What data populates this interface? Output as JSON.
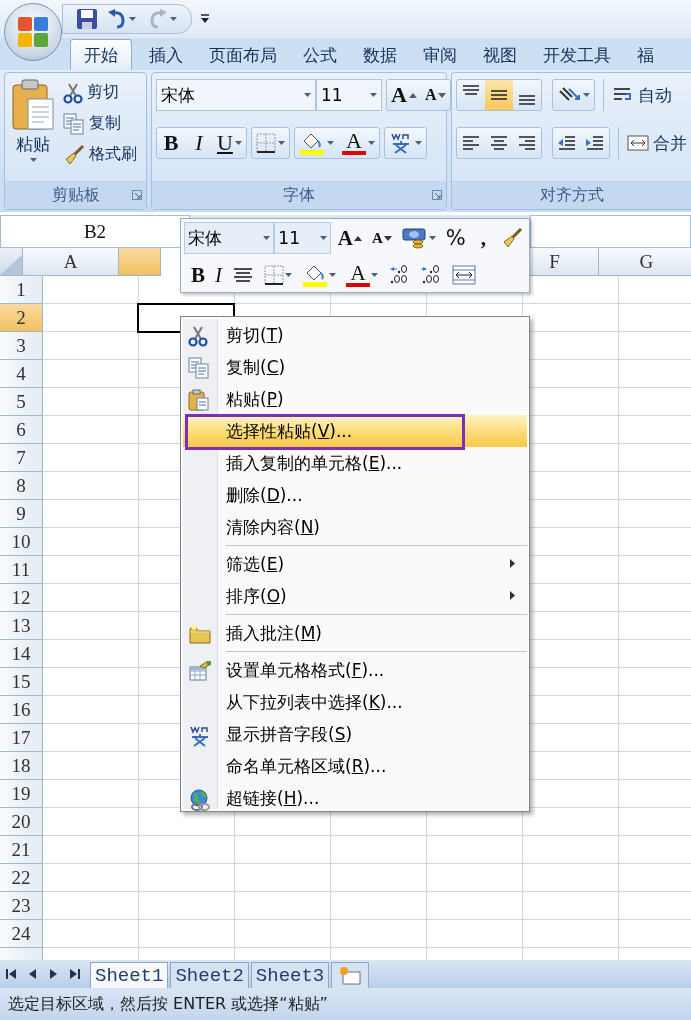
{
  "ribbon_tabs": [
    {
      "label": "开始",
      "selected": true
    },
    {
      "label": "插入",
      "selected": false
    },
    {
      "label": "页面布局",
      "selected": false
    },
    {
      "label": "公式",
      "selected": false
    },
    {
      "label": "数据",
      "selected": false
    },
    {
      "label": "审阅",
      "selected": false
    },
    {
      "label": "视图",
      "selected": false
    },
    {
      "label": "开发工具",
      "selected": false
    },
    {
      "label": "福",
      "selected": false
    }
  ],
  "clipboard": {
    "title": "剪贴板",
    "paste": "粘贴",
    "commands": [
      {
        "label": "剪切"
      },
      {
        "label": "复制"
      },
      {
        "label": "格式刷"
      }
    ]
  },
  "font": {
    "title": "字体",
    "font_name": "宋体",
    "font_size": "11",
    "grow": "A",
    "shrink": "A",
    "bold": "B",
    "italic": "I",
    "underline": "U",
    "font_color": "A"
  },
  "alignment": {
    "title": "对齐方式",
    "vertical": [
      {
        "selected": false
      },
      {
        "selected": true
      },
      {
        "selected": false
      }
    ],
    "wrap_text": "自动",
    "merge": "合并"
  },
  "name_box": "B2",
  "columns": [
    {
      "kind": "header",
      "label": "A",
      "selected": false
    },
    {
      "kind": "partial",
      "selected": true
    },
    {
      "kind": "covered"
    },
    {
      "kind": "covered"
    },
    {
      "kind": "covered"
    },
    {
      "kind": "header",
      "label": "F",
      "selected": false
    },
    {
      "kind": "header",
      "label": "G",
      "selected": false
    }
  ],
  "rows": [
    {
      "label": "1",
      "selected": false
    },
    {
      "label": "2",
      "selected": true
    },
    {
      "label": "3",
      "selected": false
    },
    {
      "label": "4",
      "selected": false
    },
    {
      "label": "5",
      "selected": false
    },
    {
      "label": "6",
      "selected": false
    },
    {
      "label": "7",
      "selected": false
    },
    {
      "label": "8",
      "selected": false
    },
    {
      "label": "9",
      "selected": false
    },
    {
      "label": "10",
      "selected": false
    },
    {
      "label": "11",
      "selected": false
    },
    {
      "label": "12",
      "selected": false
    },
    {
      "label": "13",
      "selected": false
    },
    {
      "label": "14",
      "selected": false
    },
    {
      "label": "15",
      "selected": false
    },
    {
      "label": "16",
      "selected": false
    },
    {
      "label": "17",
      "selected": false
    },
    {
      "label": "18",
      "selected": false
    },
    {
      "label": "19",
      "selected": false
    },
    {
      "label": "20",
      "selected": false
    },
    {
      "label": "21",
      "selected": false
    },
    {
      "label": "22",
      "selected": false
    },
    {
      "label": "23",
      "selected": false
    },
    {
      "label": "24",
      "selected": false
    }
  ],
  "mini_toolbar": {
    "font_name": "宋体",
    "font_size": "11",
    "grow": "A",
    "shrink": "A",
    "percent": "%",
    "comma": ",",
    "bold": "B",
    "italic": "I",
    "font_color": "A"
  },
  "context_menu": [
    {
      "label": "剪切(T)",
      "selected": false,
      "submenu": false
    },
    {
      "label": "复制(C)",
      "selected": false,
      "submenu": false
    },
    {
      "label": "粘贴(P)",
      "selected": false,
      "submenu": false
    },
    {
      "label": "选择性粘贴(V)...",
      "selected": true,
      "marked": true,
      "submenu": false
    },
    {
      "label": "插入复制的单元格(E)...",
      "selected": false,
      "submenu": false
    },
    {
      "label": "删除(D)...",
      "selected": false,
      "submenu": false
    },
    {
      "label": "清除内容(N)",
      "selected": false,
      "submenu": false
    },
    {
      "label": "筛选(E)",
      "selected": false,
      "submenu": true,
      "separator_before": true
    },
    {
      "label": "排序(O)",
      "selected": false,
      "submenu": true
    },
    {
      "label": "插入批注(M)",
      "selected": false,
      "submenu": false,
      "separator_before": true
    },
    {
      "label": "设置单元格格式(F)...",
      "selected": false,
      "submenu": false,
      "separator_before": true
    },
    {
      "label": "从下拉列表中选择(K)...",
      "selected": false,
      "submenu": false
    },
    {
      "label": "显示拼音字段(S)",
      "selected": false,
      "submenu": false
    },
    {
      "label": "命名单元格区域(R)...",
      "selected": false,
      "submenu": false
    },
    {
      "label": "超链接(H)...",
      "selected": false,
      "submenu": false
    }
  ],
  "sheet_tabs": [
    {
      "label": "Sheet1",
      "selected": true
    },
    {
      "label": "Sheet2",
      "selected": false
    },
    {
      "label": "Sheet3",
      "selected": false
    }
  ],
  "status_bar": "选定目标区域，然后按 ENTER 或选择“粘贴”"
}
